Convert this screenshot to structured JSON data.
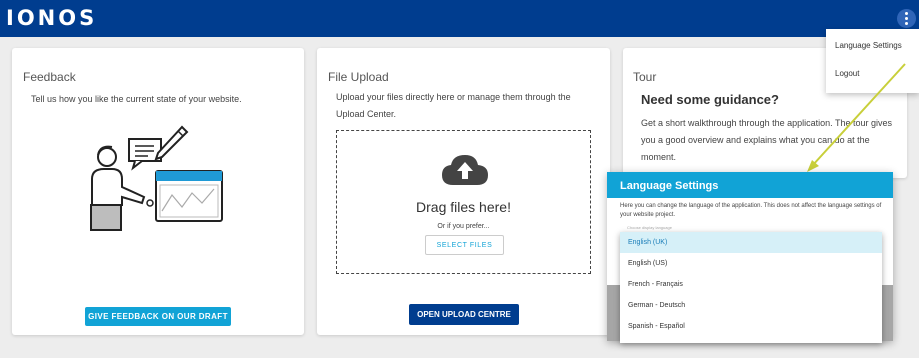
{
  "app": {
    "logo": "IONOS"
  },
  "header": {
    "menu_icon": "more-vert-icon"
  },
  "cards": {
    "feedback": {
      "title": "Feedback",
      "text": "Tell us how you like the current state of your website.",
      "button": "GIVE FEEDBACK ON OUR DRAFT"
    },
    "upload": {
      "title": "File Upload",
      "text": "Upload your files directly here or manage them through the Upload Center.",
      "drop_title": "Drag files here!",
      "drop_sub": "Or if you prefer...",
      "select_button": "SELECT FILES",
      "button": "OPEN UPLOAD CENTRE",
      "cloud_icon": "cloud-upload-icon"
    },
    "tour": {
      "title": "Tour",
      "heading": "Need some guidance?",
      "text": "Get a short walkthrough through the application. The tour gives you a good overview and explains what you can do at the moment."
    }
  },
  "user_menu": {
    "items": [
      "Language Settings",
      "Logout"
    ]
  },
  "language_modal": {
    "title": "Language Settings",
    "description": "Here you can change the language of the application. This does not affect the language settings of your website project.",
    "field_label": "Choose display language",
    "options": [
      "English (UK)",
      "English (US)",
      "French - Français",
      "German - Deutsch",
      "Spanish - Español"
    ],
    "selected": "English (UK)"
  },
  "colors": {
    "header_bg": "#003d8f",
    "accent": "#11a3d6",
    "annotation_arrow": "#c8cf3a",
    "dropdown_selected_bg": "#d6f0f8"
  }
}
